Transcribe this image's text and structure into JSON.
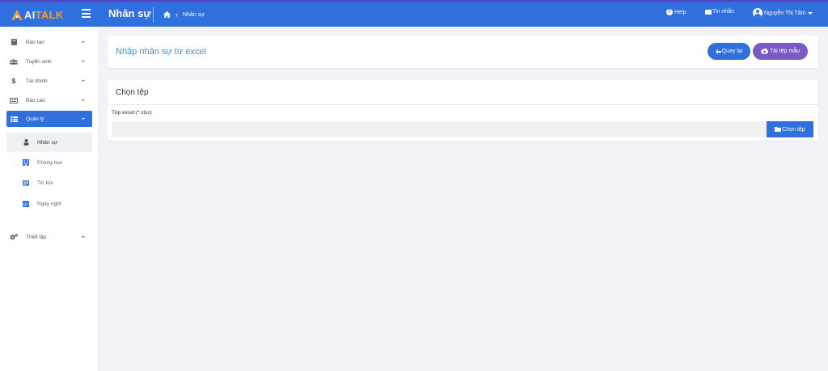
{
  "brand": {
    "prefix": "AI",
    "suffix": "TALK"
  },
  "header": {
    "title": "Nhân sự",
    "breadcrumb": "Nhân sự",
    "help_label": "Help",
    "messages_label": "Tin nhắn",
    "user_name": "Nguyễn Thị Tâm"
  },
  "sidebar": {
    "items": [
      {
        "label": "Đào tạo",
        "icon": "book-icon"
      },
      {
        "label": "Tuyển sinh",
        "icon": "users-icon"
      },
      {
        "label": "Tài chính",
        "icon": "dollar-icon"
      },
      {
        "label": "Báo cáo",
        "icon": "report-icon"
      },
      {
        "label": "Quản lý",
        "icon": "table-icon"
      },
      {
        "label": "Thiết lập",
        "icon": "gears-icon"
      }
    ],
    "sub_items": [
      {
        "label": "Nhân sự",
        "icon": "person-icon"
      },
      {
        "label": "Phòng học",
        "icon": "building-icon"
      },
      {
        "label": "Tin tức",
        "icon": "news-icon"
      },
      {
        "label": "Ngày nghỉ",
        "icon": "calendar-icon"
      }
    ]
  },
  "main": {
    "page_heading": "Nhập nhân sự từ excel",
    "back_button": "Quay lại",
    "template_button": "Tải tệp mẫu",
    "section_title": "Chọn tệp",
    "file_label": "Tệp excel:(*.xlsx)",
    "choose_button": "Chọn tệp"
  },
  "colors": {
    "primary": "#2f6fde",
    "purple": "#7a58c8",
    "logo_orange": "#f39c34"
  }
}
